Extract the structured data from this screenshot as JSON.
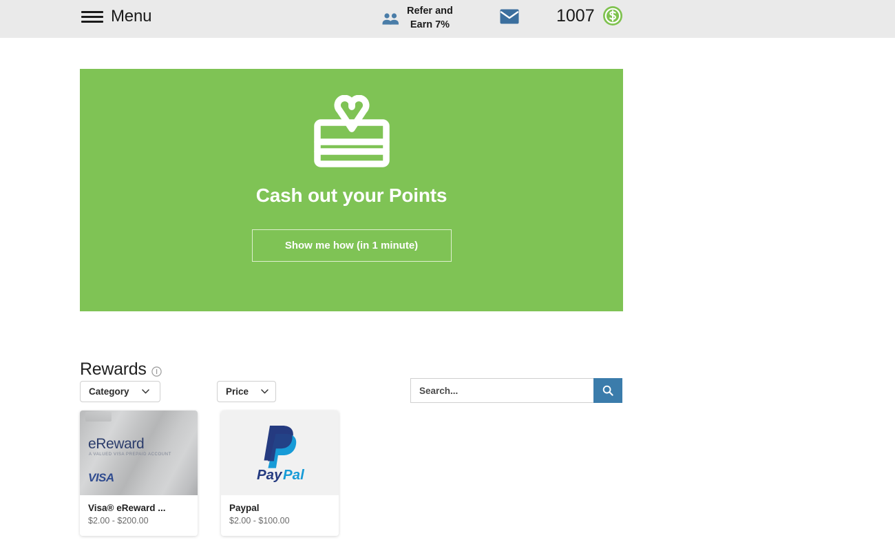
{
  "header": {
    "menu_label": "Menu",
    "menu_icon": "hamburger-icon",
    "refer_line1": "Refer and",
    "refer_line2": "Earn 7%",
    "refer_icon": "people-icon",
    "mail_icon": "envelope-icon",
    "points_value": "1007",
    "points_icon": "coin-icon",
    "background_color": "#eaeaea"
  },
  "banner": {
    "icon": "gift-icon",
    "title": "Cash out your Points",
    "cta_label": "Show me how (in 1 minute)",
    "background_color": "#7fc355",
    "text_color": "#ffffff"
  },
  "rewards": {
    "title": "Rewards",
    "info_icon": "info-circle-icon",
    "filters": [
      {
        "label": "Category",
        "icon": "chevron-down-icon"
      },
      {
        "label": "Price",
        "icon": "chevron-down-icon"
      }
    ],
    "search": {
      "placeholder": "Search...",
      "value": "",
      "button_icon": "search-icon",
      "button_color": "#3b7cab"
    },
    "cards": [
      {
        "logo": "visa-ereward-card-image",
        "brand_word": "eReward",
        "brand_sub": "A VALUED VISA PREPAID ACCOUNT",
        "network": "VISA",
        "title": "Visa® eReward ...",
        "price_range": "$2.00 - $200.00"
      },
      {
        "logo": "paypal-logo",
        "title": "Paypal",
        "price_range": "$2.00 - $100.00"
      }
    ]
  },
  "colors": {
    "brand_green": "#7fc355",
    "header_gray": "#eaeaea",
    "search_blue": "#3b7cab",
    "paypal_dark": "#253b80",
    "paypal_light": "#179bd7"
  }
}
